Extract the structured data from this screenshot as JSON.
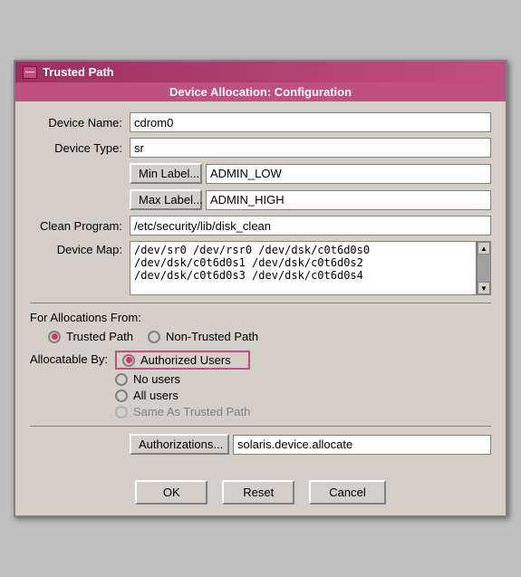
{
  "window": {
    "title": "Trusted Path",
    "subtitle": "Device Allocation: Configuration",
    "close_btn_label": "—"
  },
  "form": {
    "device_name_label": "Device Name:",
    "device_name_value": "cdrom0",
    "device_type_label": "Device Type:",
    "device_type_value": "sr",
    "min_label_btn": "Min Label...",
    "min_label_value": "ADMIN_LOW",
    "max_label_btn": "Max Label...",
    "max_label_value": "ADMIN_HIGH",
    "clean_program_label": "Clean Program:",
    "clean_program_value": "/etc/security/lib/disk_clean",
    "device_map_label": "Device Map:",
    "device_map_value": "/dev/sr0 /dev/rsr0 /dev/dsk/c0t6d0s0\n/dev/dsk/c0t6d0s1 /dev/dsk/c0t6d0s2\n/dev/dsk/c0t6d0s3 /dev/dsk/c0t6d0s4"
  },
  "allocations_from": {
    "section_label": "For Allocations From:",
    "trusted_path_label": "Trusted Path",
    "non_trusted_path_label": "Non-Trusted Path",
    "trusted_selected": true
  },
  "allocatable_by": {
    "label": "Allocatable By:",
    "options": [
      {
        "label": "Authorized Users",
        "selected": true,
        "disabled": false
      },
      {
        "label": "No users",
        "selected": false,
        "disabled": false
      },
      {
        "label": "All users",
        "selected": false,
        "disabled": false
      },
      {
        "label": "Same As Trusted Path",
        "selected": false,
        "disabled": true
      }
    ]
  },
  "authorizations": {
    "btn_label": "Authorizations...",
    "value": "solaris.device.allocate"
  },
  "buttons": {
    "ok": "OK",
    "reset": "Reset",
    "cancel": "Cancel"
  }
}
